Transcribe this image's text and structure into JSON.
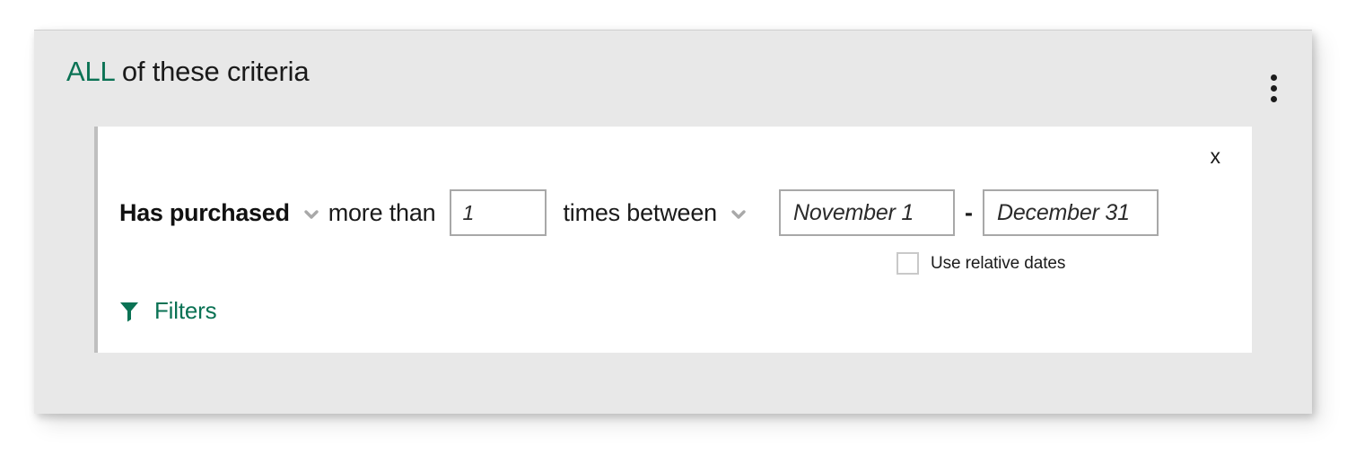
{
  "colors": {
    "accent_green": "#0a7254",
    "card_background": "#e8e8e8",
    "panel_background": "#ffffff",
    "panel_accent_border": "#bfbfbf",
    "input_border": "#a8a8a8",
    "text_primary": "#1a1a1a",
    "chevron_gray": "#a9a9a9",
    "checkbox_border": "#c9c9c9"
  },
  "card": {
    "title": {
      "all_word": "ALL",
      "rest": " of these criteria"
    },
    "menu_icon": "kebab-menu-icon"
  },
  "panel": {
    "close_label": "x",
    "criteria": {
      "attribute": {
        "label": "Has purchased",
        "chevron_icon": "chevron-down-icon"
      },
      "operator": {
        "label": "more than",
        "chevron_icon": null
      },
      "count": {
        "value": "",
        "placeholder": "1"
      },
      "between": {
        "label": "times between",
        "chevron_icon": "chevron-down-icon"
      },
      "date_start": {
        "value": "",
        "placeholder": "November 1"
      },
      "date_separator": "-",
      "date_end": {
        "value": "",
        "placeholder": "December 31"
      }
    },
    "relative_dates": {
      "label": "Use relative dates",
      "checked": false
    },
    "filters": {
      "label": "Filters",
      "icon": "filter-funnel-icon"
    }
  }
}
